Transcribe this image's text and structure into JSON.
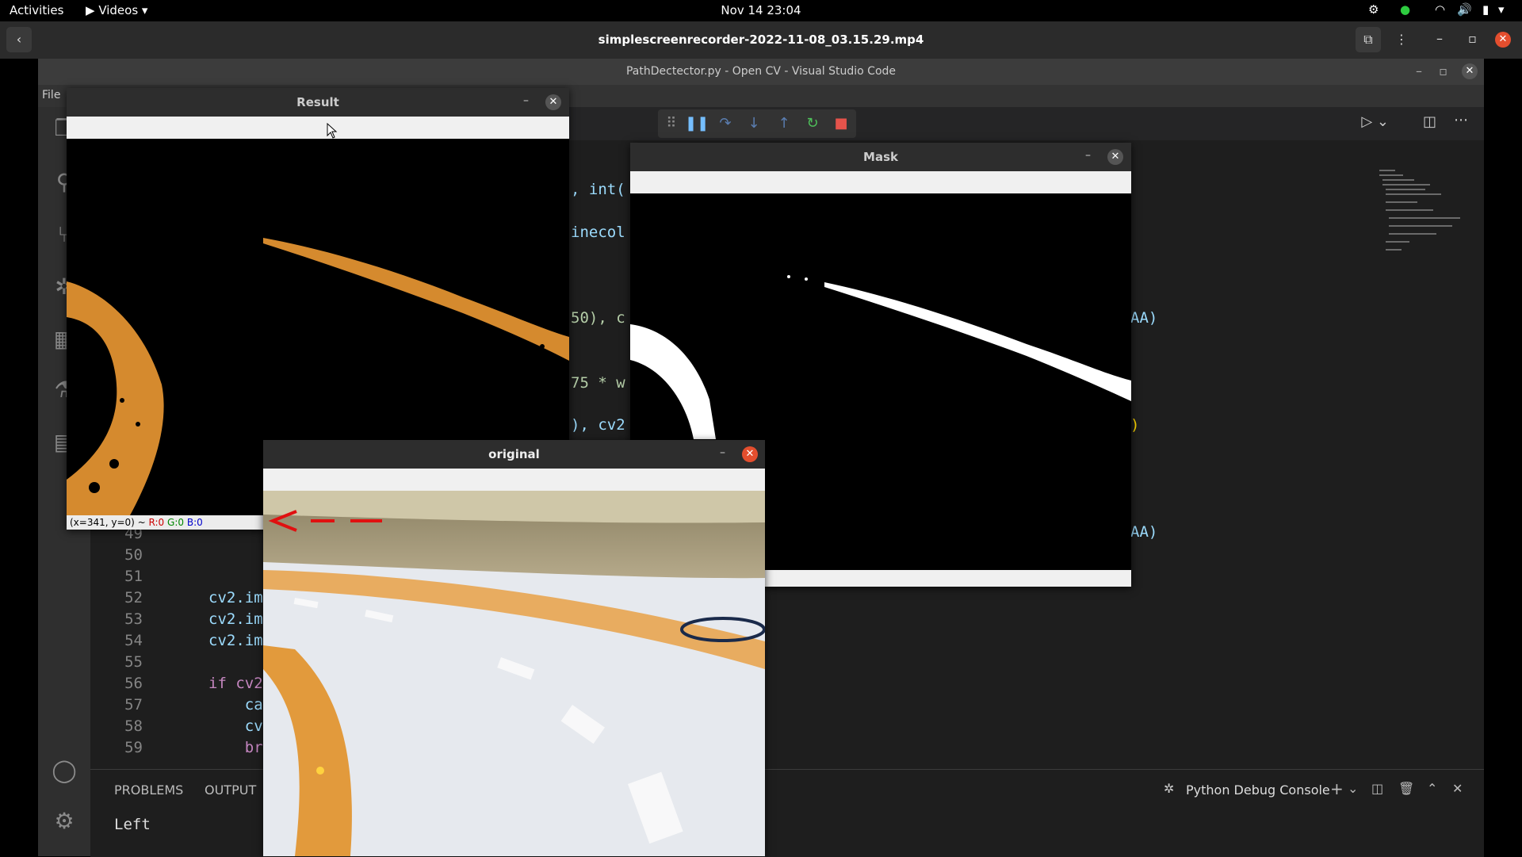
{
  "topbar": {
    "activities": "Activities",
    "app_menu": "Videos",
    "clock": "Nov 14  23:04"
  },
  "player": {
    "title": "simplescreenrecorder-2022-11-08_03.15.29.mp4"
  },
  "vscode": {
    "window_title": "PathDectector.py - Open CV - Visual Studio Code",
    "menu_file": "File",
    "code_fragments": {
      "f1": ", int(",
      "f2": "inecol",
      "f3": "50), c",
      "f4": "75 * w",
      "f5": "), cv2",
      "r1": "AA)",
      "r2": ")",
      "r3": "AA)"
    },
    "lines": [
      {
        "n": "49",
        "code": ""
      },
      {
        "n": "50",
        "code": ""
      },
      {
        "n": "51",
        "code": ""
      },
      {
        "n": "52",
        "code": "cv2.im"
      },
      {
        "n": "53",
        "code": "cv2.im"
      },
      {
        "n": "54",
        "code": "cv2.im"
      },
      {
        "n": "55",
        "code": ""
      },
      {
        "n": "56",
        "code": "if cv2"
      },
      {
        "n": "57",
        "code": "    ca"
      },
      {
        "n": "58",
        "code": "    cv"
      },
      {
        "n": "59",
        "code": "    br"
      }
    ],
    "panel": {
      "tab_problems": "PROBLEMS",
      "tab_output": "OUTPUT",
      "debug_console": "Python Debug Console",
      "output_text": "Left"
    }
  },
  "windows": {
    "result": {
      "title": "Result",
      "status": "(x=341, y=0) ~",
      "r": "R:0",
      "g": "G:0",
      "b": "B:0"
    },
    "mask": {
      "title": "Mask"
    },
    "original": {
      "title": "original"
    }
  },
  "colors": {
    "path_orange": "#d58a2e",
    "close_red": "#e34e2e",
    "debug_green": "#4ec05a",
    "debug_stop": "#e5534b"
  }
}
